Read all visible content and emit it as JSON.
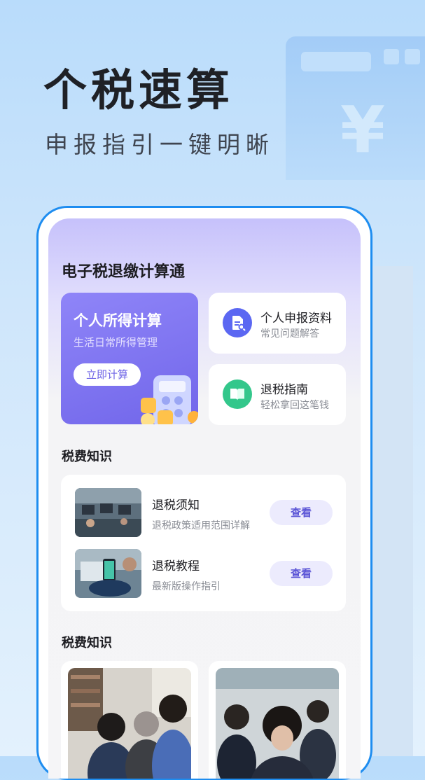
{
  "hero": {
    "title": "个税速算",
    "subtitle": "申报指引一键明晰",
    "decor_symbol": "¥"
  },
  "app": {
    "title": "电子税退缴计算通",
    "main_card": {
      "title": "个人所得计算",
      "subtitle": "生活日常所得管理",
      "button": "立即计算"
    },
    "side_cards": [
      {
        "title": "个人申报资料",
        "subtitle": "常见问题解答",
        "icon": "document-search-icon",
        "color": "#5b67f2"
      },
      {
        "title": "退税指南",
        "subtitle": "轻松拿回这笔钱",
        "icon": "open-book-icon",
        "color": "#33c78b"
      }
    ],
    "section1": {
      "title": "税费知识",
      "items": [
        {
          "title": "退税须知",
          "subtitle": "退税政策适用范围详解",
          "button": "查看"
        },
        {
          "title": "退税教程",
          "subtitle": "最新版操作指引",
          "button": "查看"
        }
      ]
    },
    "section2": {
      "title": "税费知识"
    }
  },
  "colors": {
    "accent": "#7166ea",
    "frame": "#1e8df0",
    "green": "#33c78b"
  }
}
